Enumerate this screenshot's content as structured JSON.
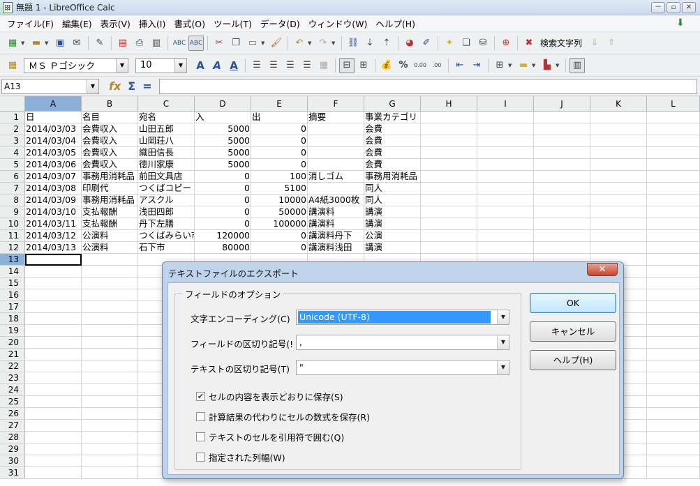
{
  "window": {
    "title": "無題 1 - LibreOffice Calc",
    "controls": [
      "－",
      "▫",
      "✕"
    ]
  },
  "menu": [
    "ファイル(F)",
    "編集(E)",
    "表示(V)",
    "挿入(I)",
    "書式(O)",
    "ツール(T)",
    "データ(D)",
    "ウィンドウ(W)",
    "ヘルプ(H)"
  ],
  "toolbar": {
    "find_label": "検索文字列",
    "font_name": "ＭＳ Ｐゴシック",
    "font_size": "10"
  },
  "formula_bar": {
    "name_box": "A13",
    "formula": ""
  },
  "sheet": {
    "columns": [
      "A",
      "B",
      "C",
      "D",
      "E",
      "F",
      "G",
      "H",
      "I",
      "J",
      "K",
      "L"
    ],
    "selected_column": "A",
    "selected_row": 13,
    "active_cell": "A13",
    "rows": [
      [
        "日",
        "名目",
        "宛名",
        "入",
        "出",
        "摘要",
        "事業カテゴリ"
      ],
      [
        "2014/03/03",
        "会費収入",
        "山田五郎",
        "5000",
        "0",
        "",
        "会費"
      ],
      [
        "2014/03/04",
        "会費収入",
        "山岡荘八",
        "5000",
        "0",
        "",
        "会費"
      ],
      [
        "2014/03/05",
        "会費収入",
        "織田信長",
        "5000",
        "0",
        "",
        "会費"
      ],
      [
        "2014/03/06",
        "会費収入",
        "徳川家康",
        "5000",
        "0",
        "",
        "会費"
      ],
      [
        "2014/03/07",
        "事務用消耗品",
        "前田文具店",
        "0",
        "100",
        "消しゴム",
        "事務用消耗品"
      ],
      [
        "2014/03/08",
        "印刷代",
        "つくばコピー",
        "0",
        "5100",
        "",
        "同人"
      ],
      [
        "2014/03/09",
        "事務用消耗品",
        "アスクル",
        "0",
        "10000",
        "A4紙3000枚",
        "同人"
      ],
      [
        "2014/03/10",
        "支払報酬",
        "浅田四郎",
        "0",
        "50000",
        "講演料",
        "講演"
      ],
      [
        "2014/03/11",
        "支払報酬",
        "丹下左膳",
        "0",
        "100000",
        "講演料",
        "講演"
      ],
      [
        "2014/03/12",
        "公演料",
        "つくばみらい市",
        "120000",
        "0",
        "講演料丹下",
        "公演"
      ],
      [
        "2014/03/13",
        "公演料",
        "石下市",
        "80000",
        "0",
        "講演料浅田",
        "講演"
      ]
    ],
    "row_numbers": [
      "1",
      "2",
      "3",
      "4",
      "5",
      "6",
      "7",
      "8",
      "9",
      "10",
      "11",
      "12",
      "13",
      "14",
      "15",
      "16",
      "17",
      "18",
      "19",
      "20",
      "21",
      "22",
      "23",
      "24",
      "25",
      "26",
      "27",
      "28",
      "29",
      "30",
      "31"
    ]
  },
  "dialog": {
    "title": "テキストファイルのエクスポート",
    "group_label": "フィールドのオプション",
    "encoding_label": "文字エンコーディング(C)",
    "encoding_value": "Unicode (UTF-8)",
    "field_sep_label": "フィールドの区切り記号(!",
    "field_sep_value": ",",
    "text_sep_label": "テキストの区切り記号(T)",
    "text_sep_value": "\"",
    "checkboxes": [
      {
        "label": "セルの内容を表示どおりに保存(S)",
        "checked": true
      },
      {
        "label": "計算結果の代わりにセルの数式を保存(R)",
        "checked": false
      },
      {
        "label": "テキストのセルを引用符で囲む(Q)",
        "checked": false
      },
      {
        "label": "指定された列幅(W)",
        "checked": false
      }
    ],
    "ok_label": "OK",
    "cancel_label": "キャンセル",
    "help_label": "ヘルプ(H)",
    "close_glyph": "✕"
  }
}
